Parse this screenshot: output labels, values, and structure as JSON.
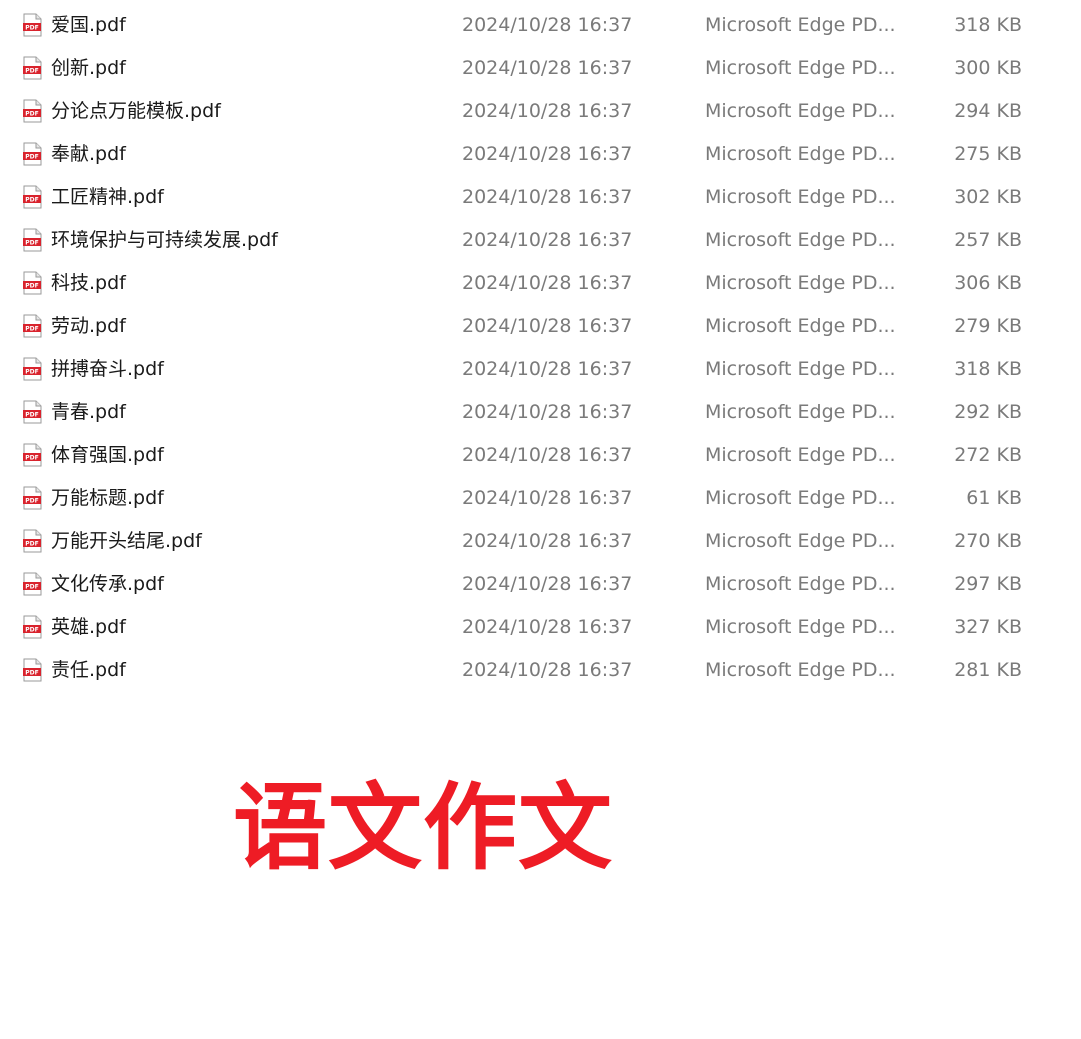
{
  "colors": {
    "name_text": "#1a1a1a",
    "meta_text": "#7a7a7a",
    "pdf_icon_red": "#d9232d",
    "caption_red": "#ee1c25"
  },
  "file_icon": "pdf-file-icon",
  "files": [
    {
      "name": "爱国.pdf",
      "modified": "2024/10/28 16:37",
      "type": "Microsoft Edge PD...",
      "size": "318 KB"
    },
    {
      "name": "创新.pdf",
      "modified": "2024/10/28 16:37",
      "type": "Microsoft Edge PD...",
      "size": "300 KB"
    },
    {
      "name": "分论点万能模板.pdf",
      "modified": "2024/10/28 16:37",
      "type": "Microsoft Edge PD...",
      "size": "294 KB"
    },
    {
      "name": "奉献.pdf",
      "modified": "2024/10/28 16:37",
      "type": "Microsoft Edge PD...",
      "size": "275 KB"
    },
    {
      "name": "工匠精神.pdf",
      "modified": "2024/10/28 16:37",
      "type": "Microsoft Edge PD...",
      "size": "302 KB"
    },
    {
      "name": "环境保护与可持续发展.pdf",
      "modified": "2024/10/28 16:37",
      "type": "Microsoft Edge PD...",
      "size": "257 KB"
    },
    {
      "name": "科技.pdf",
      "modified": "2024/10/28 16:37",
      "type": "Microsoft Edge PD...",
      "size": "306 KB"
    },
    {
      "name": "劳动.pdf",
      "modified": "2024/10/28 16:37",
      "type": "Microsoft Edge PD...",
      "size": "279 KB"
    },
    {
      "name": "拼搏奋斗.pdf",
      "modified": "2024/10/28 16:37",
      "type": "Microsoft Edge PD...",
      "size": "318 KB"
    },
    {
      "name": "青春.pdf",
      "modified": "2024/10/28 16:37",
      "type": "Microsoft Edge PD...",
      "size": "292 KB"
    },
    {
      "name": "体育强国.pdf",
      "modified": "2024/10/28 16:37",
      "type": "Microsoft Edge PD...",
      "size": "272 KB"
    },
    {
      "name": "万能标题.pdf",
      "modified": "2024/10/28 16:37",
      "type": "Microsoft Edge PD...",
      "size": "61 KB"
    },
    {
      "name": "万能开头结尾.pdf",
      "modified": "2024/10/28 16:37",
      "type": "Microsoft Edge PD...",
      "size": "270 KB"
    },
    {
      "name": "文化传承.pdf",
      "modified": "2024/10/28 16:37",
      "type": "Microsoft Edge PD...",
      "size": "297 KB"
    },
    {
      "name": "英雄.pdf",
      "modified": "2024/10/28 16:37",
      "type": "Microsoft Edge PD...",
      "size": "327 KB"
    },
    {
      "name": "责任.pdf",
      "modified": "2024/10/28 16:37",
      "type": "Microsoft Edge PD...",
      "size": "281 KB"
    }
  ],
  "caption": "语文作文"
}
